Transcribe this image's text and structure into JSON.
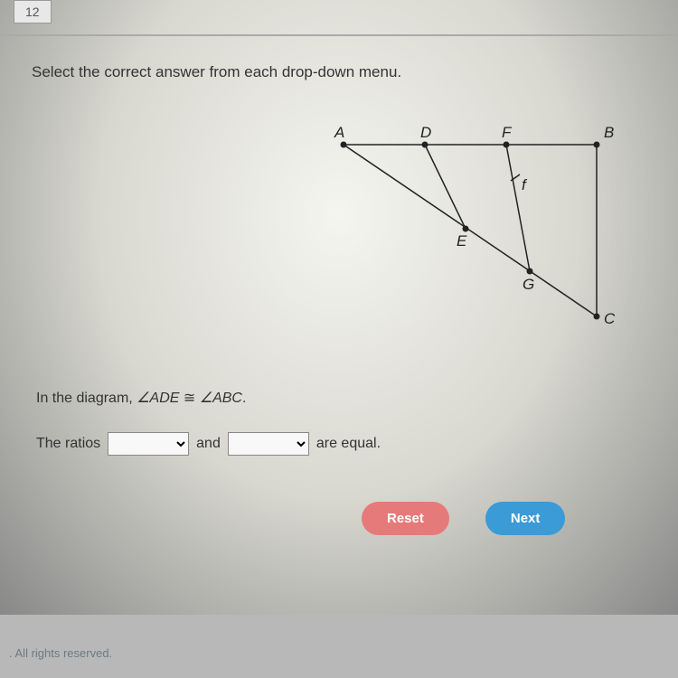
{
  "page_number": "12",
  "instruction": "Select the correct answer from each drop-down menu.",
  "diagram": {
    "points": {
      "A": "A",
      "D": "D",
      "F": "F",
      "B": "B",
      "E": "E",
      "G": "G",
      "C": "C"
    },
    "segment_label": "f"
  },
  "statement": {
    "prefix": "In the diagram, ",
    "angle1": "∠ADE",
    "congruent": " ≅ ",
    "angle2": "∠ABC",
    "suffix": "."
  },
  "ratios": {
    "prefix": "The ratios",
    "and": "and",
    "suffix": "are equal."
  },
  "buttons": {
    "reset": "Reset",
    "next": "Next"
  },
  "footer": ". All rights reserved."
}
